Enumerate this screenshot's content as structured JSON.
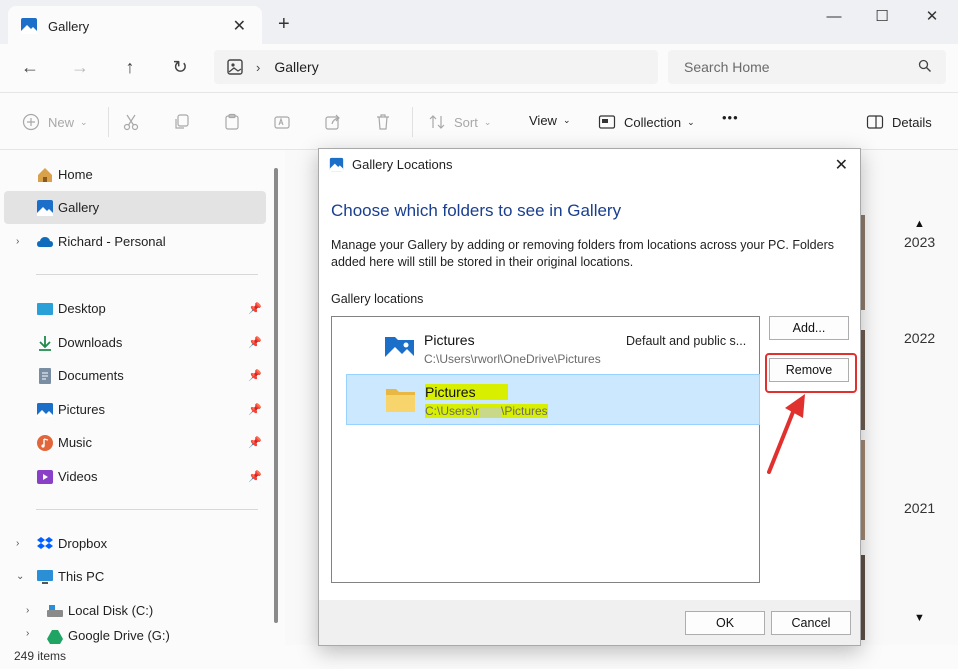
{
  "window": {
    "tab_title": "Gallery",
    "tab_close": "✕",
    "new_tab": "+",
    "minimize": "—",
    "maximize": "☐",
    "close": "✕"
  },
  "address": {
    "back": "←",
    "forward": "→",
    "up": "↑",
    "refresh": "↻",
    "separator": "›",
    "breadcrumb": "Gallery",
    "search_placeholder": "Search Home"
  },
  "commands": {
    "new": "New",
    "sort": "Sort",
    "view": "View",
    "collection": "Collection",
    "more": "•••",
    "details": "Details"
  },
  "sidebar": {
    "items": [
      {
        "label": "Home"
      },
      {
        "label": "Gallery"
      },
      {
        "label": "Richard - Personal"
      },
      {
        "label": "Desktop"
      },
      {
        "label": "Downloads"
      },
      {
        "label": "Documents"
      },
      {
        "label": "Pictures"
      },
      {
        "label": "Music"
      },
      {
        "label": "Videos"
      },
      {
        "label": "Dropbox"
      },
      {
        "label": "This PC"
      },
      {
        "label": "Local Disk (C:)"
      },
      {
        "label": "Google Drive (G:)"
      }
    ]
  },
  "status": {
    "items": "249 items"
  },
  "timeline": {
    "years": [
      "2023",
      "2022",
      "2021"
    ]
  },
  "dialog": {
    "title": "Gallery Locations",
    "heading": "Choose which folders to see in Gallery",
    "description": "Manage your Gallery by adding or removing folders from locations across your PC. Folders added here will still be stored in their original locations.",
    "list_label": "Gallery locations",
    "locations": [
      {
        "name": "Pictures",
        "path": "C:\\Users\\rworl\\OneDrive\\Pictures",
        "note": "Default and public s..."
      },
      {
        "name": "Pictures",
        "path": "C:\\Users\\r",
        "path_end": "\\Pictures",
        "note": ""
      }
    ],
    "add_button": "Add...",
    "remove_button": "Remove",
    "ok_button": "OK",
    "cancel_button": "Cancel"
  },
  "colors": {
    "accent": "#0067c0",
    "heading": "#1a3f8f",
    "highlight": "#d8f000",
    "annotation": "#e0312f",
    "selection": "#cce8ff"
  }
}
